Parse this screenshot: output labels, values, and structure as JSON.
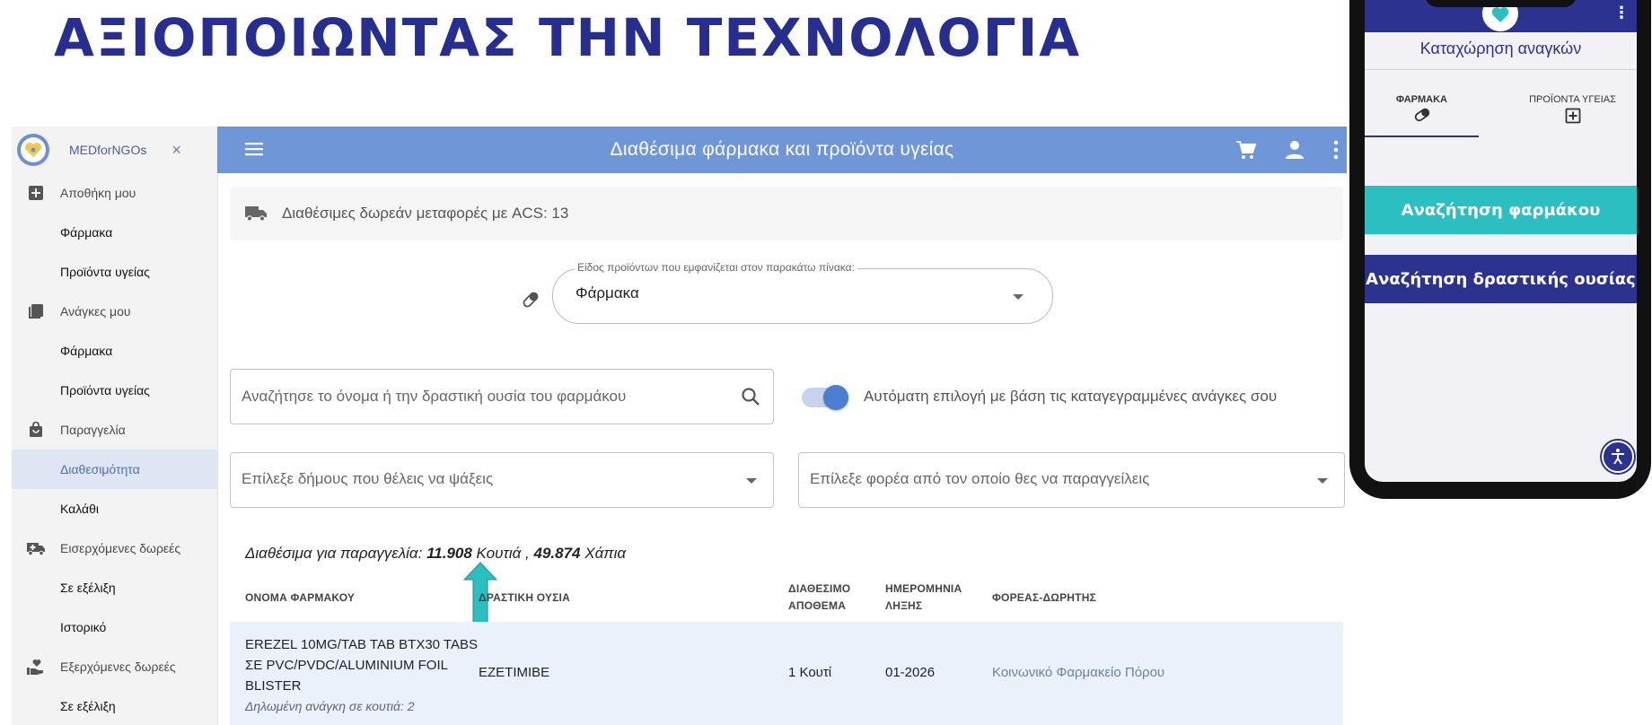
{
  "headline": "ΑΞΙΟΠΟΙΩΝΤΑΣ ΤΗΝ ΤΕΧΝΟΛΟΓΙΑ",
  "sidebar": {
    "brand": "MEDforNGOs",
    "close": "×",
    "sections": [
      {
        "label": "Αποθήκη μου",
        "icon": "plus-box-icon"
      },
      {
        "label": "Φάρμακα"
      },
      {
        "label": "Προϊόντα υγείας"
      },
      {
        "label": "Ανάγκες μου",
        "icon": "book-icon"
      },
      {
        "label": "Φάρμακα"
      },
      {
        "label": "Προϊόντα υγείας"
      },
      {
        "label": "Παραγγελία",
        "icon": "bag-icon"
      },
      {
        "label": "Διαθεσιμότητα"
      },
      {
        "label": "Καλάθι"
      },
      {
        "label": "Εισερχόμενες δωρεές",
        "icon": "ambulance-icon"
      },
      {
        "label": "Σε εξέλιξη"
      },
      {
        "label": "Ιστορικό"
      },
      {
        "label": "Εξερχόμενες δωρεές",
        "icon": "hand-heart-icon"
      },
      {
        "label": "Σε εξέλιξη"
      }
    ]
  },
  "topbar": {
    "title": "Διαθέσιμα φάρμακα και προϊόντα υγείας"
  },
  "main": {
    "banner": "Διαθέσιμες δωρεάν μεταφορές με ACS: 13",
    "product_type": {
      "label": "Είδος προϊόντων που εμφανίζεται στον παρακάτω πίνακα:",
      "value": "Φάρμακα"
    },
    "search_placeholder": "Αναζήτησε το όνομα ή την δραστική ουσία του φαρμάκου",
    "toggle_label": "Αυτόματη επιλογή με βάση τις καταγεγραμμένες ανάγκες σου",
    "municipality_placeholder": "Επίλεξε δήμους που θέλεις να ψάξεις",
    "carrier_placeholder": "Επίλεξε φορέα από τον οποίο θες να παραγγείλεις",
    "availability": {
      "prefix": "Διαθέσιμα για παραγγελία:",
      "boxes": "11.908",
      "boxes_unit": "Κουτιά ,",
      "blisters": "49.874",
      "blisters_unit": "Χάπια"
    },
    "table": {
      "headers": {
        "name": "ΟΝΟΜΑ ΦΑΡΜΑΚΟΥ",
        "substance": "ΔΡΑΣΤΙΚΗ ΟΥΣΙΑ",
        "stock_1": "ΔΙΑΘΕΣΙΜΟ",
        "stock_2": "ΑΠΟΘΕΜΑ",
        "expiry_1": "ΗΜΕΡΟΜΗΝΙΑ",
        "expiry_2": "ΛΗΞΗΣ",
        "donor": "ΦΟΡΕΑΣ-ΔΩΡΗΤΗΣ"
      },
      "rows": [
        {
          "name": "EREZEL 10MG/TAB TAB BTX30 TABS ΣΕ PVC/PVDC/ALUMINIUM FOIL BLISTER",
          "note": "Δηλωμένη ανάγκη σε κουτιά: 2",
          "substance": "EZETIMIBE",
          "stock": "1 Κουτί",
          "expiry": "01-2026",
          "donor": "Κοινωνικό Φαρμακείο Πόρου"
        }
      ]
    }
  },
  "phone": {
    "title": "Καταχώρηση αναγκών",
    "tab1": "ΦΑΡΜΑΚΑ",
    "tab2": "ΠΡΟΪΟΝΤΑ ΥΓΕΙΑΣ",
    "btn_medicine": "Αναζήτηση φαρμάκου",
    "btn_substance": "Αναζήτηση δραστικής ουσίας"
  },
  "colors": {
    "headline": "#262e8f",
    "topbar": "#6f97d8",
    "navy": "#2b3290",
    "teal": "#2bbfc1",
    "arrow": "#2bbfc1"
  }
}
